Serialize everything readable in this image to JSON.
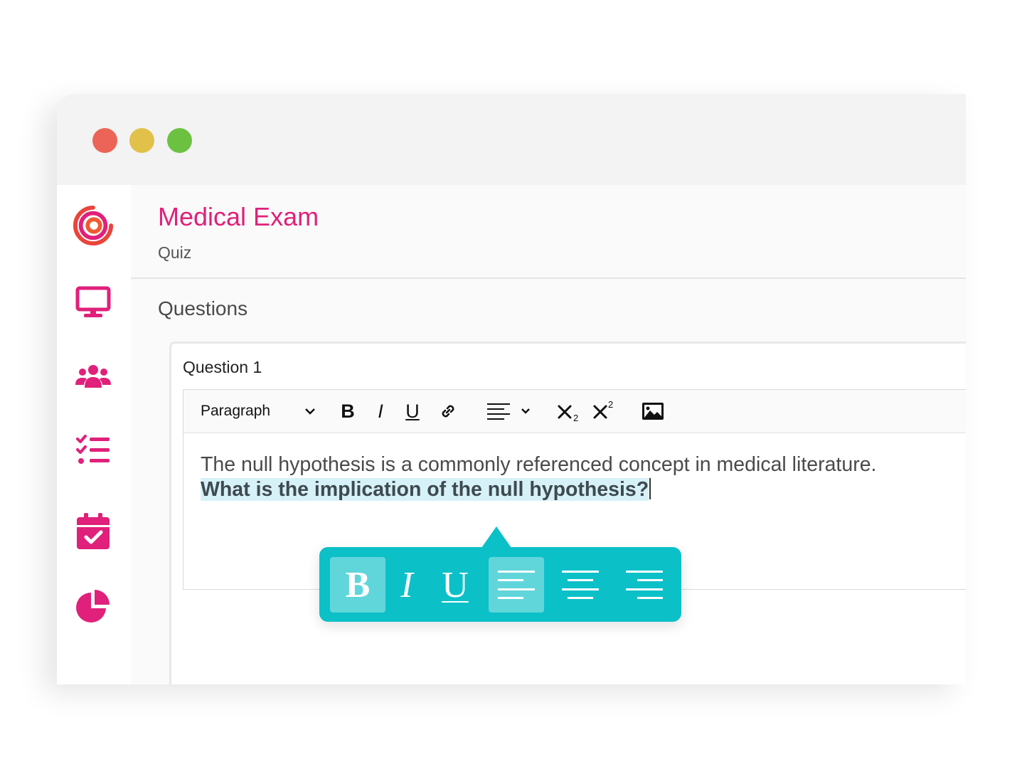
{
  "window": {
    "traffic_lights": [
      "close",
      "minimize",
      "maximize"
    ]
  },
  "sidebar": {
    "items": [
      {
        "icon": "logo-icon"
      },
      {
        "icon": "monitor-icon"
      },
      {
        "icon": "users-icon"
      },
      {
        "icon": "checklist-icon"
      },
      {
        "icon": "calendar-check-icon"
      },
      {
        "icon": "pie-chart-icon"
      }
    ],
    "accent_color": "#e0207a"
  },
  "header": {
    "title": "Medical Exam",
    "subtitle": "Quiz"
  },
  "main": {
    "section_title": "Questions",
    "question": {
      "label": "Question 1",
      "toolbar": {
        "paragraph_select": "Paragraph",
        "bold": "B",
        "italic": "I",
        "underline": "U"
      },
      "content": {
        "line1": "The null hypothesis is a commonly referenced concept in medical literature.",
        "line2_selected": "What is the implication of the null hypothesis?"
      }
    }
  },
  "floating_toolbar": {
    "color": "#0cc0c8",
    "bold": "B",
    "italic": "I",
    "underline": "U"
  }
}
